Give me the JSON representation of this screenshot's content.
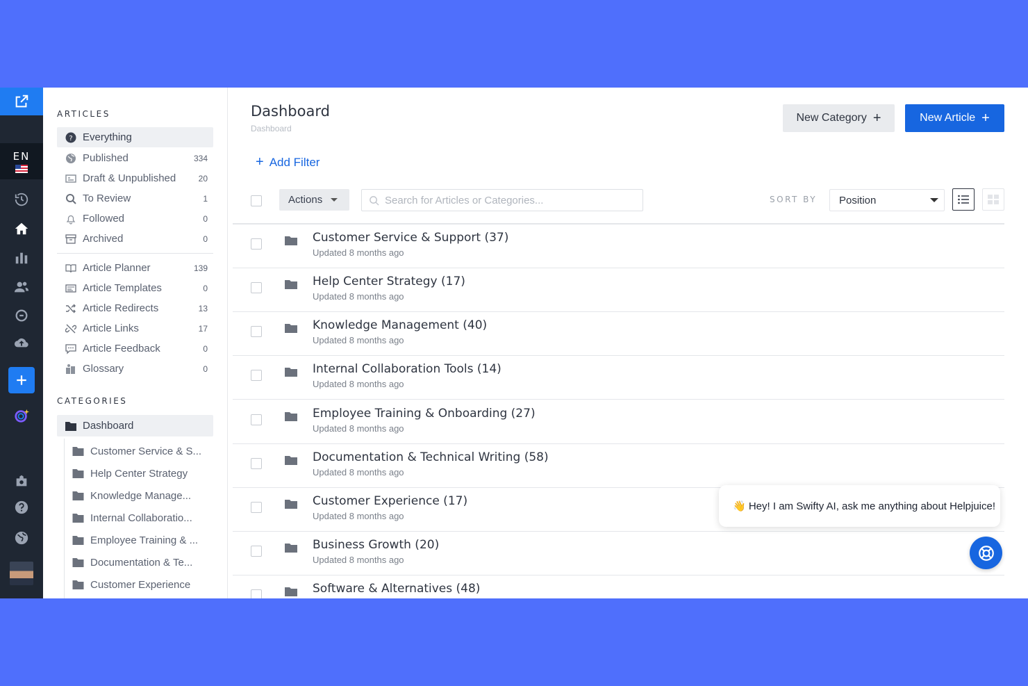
{
  "rail": {
    "language_code": "EN"
  },
  "sidebar": {
    "articles_title": "ARTICLES",
    "articles": [
      {
        "label": "Everything",
        "count": "",
        "icon": "question-circle-icon"
      },
      {
        "label": "Published",
        "count": "334",
        "icon": "globe-icon"
      },
      {
        "label": "Draft & Unpublished",
        "count": "20",
        "icon": "draft-icon"
      },
      {
        "label": "To Review",
        "count": "1",
        "icon": "search-review-icon"
      },
      {
        "label": "Followed",
        "count": "0",
        "icon": "bell-icon"
      },
      {
        "label": "Archived",
        "count": "0",
        "icon": "archive-icon"
      }
    ],
    "tools": [
      {
        "label": "Article Planner",
        "count": "139",
        "icon": "book-icon"
      },
      {
        "label": "Article Templates",
        "count": "0",
        "icon": "template-icon"
      },
      {
        "label": "Article Redirects",
        "count": "13",
        "icon": "shuffle-icon"
      },
      {
        "label": "Article Links",
        "count": "17",
        "icon": "broken-link-icon"
      },
      {
        "label": "Article Feedback",
        "count": "0",
        "icon": "comment-icon"
      },
      {
        "label": "Glossary",
        "count": "0",
        "icon": "glossary-icon"
      }
    ],
    "categories_title": "CATEGORIES",
    "category_root": "Dashboard",
    "categories": [
      "Customer Service & S...",
      "Help Center Strategy",
      "Knowledge Manage...",
      "Internal Collaboratio...",
      "Employee Training & ...",
      "Documentation & Te...",
      "Customer Experience"
    ]
  },
  "main": {
    "title": "Dashboard",
    "breadcrumb": "Dashboard",
    "new_category_label": "New Category",
    "new_article_label": "New Article",
    "add_filter_label": "Add Filter",
    "actions_label": "Actions",
    "search_placeholder": "Search for Articles or Categories...",
    "sort_by_label": "SORT BY",
    "sort_value": "Position",
    "rows": [
      {
        "name": "Customer Service & Support (37)",
        "updated": "Updated 8 months ago"
      },
      {
        "name": "Help Center Strategy (17)",
        "updated": "Updated 8 months ago"
      },
      {
        "name": "Knowledge Management (40)",
        "updated": "Updated 8 months ago"
      },
      {
        "name": "Internal Collaboration Tools (14)",
        "updated": "Updated 8 months ago"
      },
      {
        "name": "Employee Training & Onboarding (27)",
        "updated": "Updated 8 months ago"
      },
      {
        "name": "Documentation & Technical Writing (58)",
        "updated": "Updated 8 months ago"
      },
      {
        "name": "Customer Experience (17)",
        "updated": "Updated 8 months ago"
      },
      {
        "name": "Business Growth (20)",
        "updated": "Updated 8 months ago"
      },
      {
        "name": "Software & Alternatives (48)",
        "updated": ""
      }
    ]
  },
  "chat": {
    "message": "👋 Hey! I am Swifty AI, ask me anything about Helpjuice!"
  },
  "colors": {
    "background": "#4f6ffc",
    "rail": "#1f2733",
    "accent": "#1766e0"
  }
}
